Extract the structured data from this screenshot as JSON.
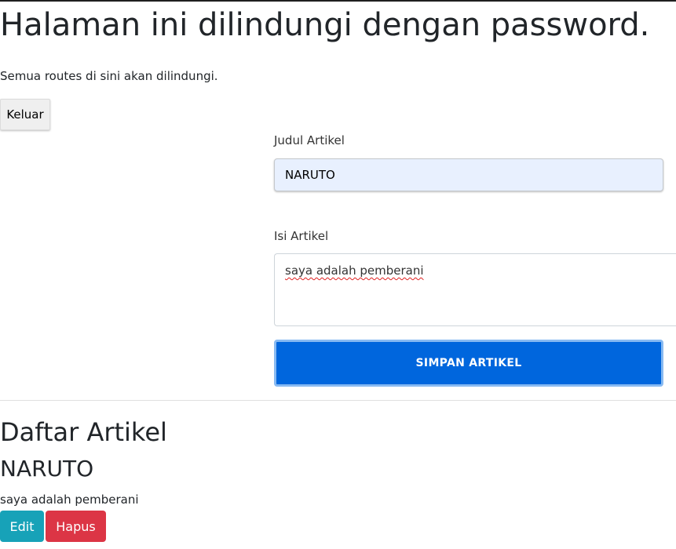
{
  "header": {
    "title": "Halaman ini dilindungi dengan password.",
    "description": "Semua routes di sini akan dilindungi.",
    "logout_label": "Keluar"
  },
  "form": {
    "title_label": "Judul Artikel",
    "title_value": "NARUTO",
    "content_label": "Isi Artikel",
    "content_value": "saya adalah pemberani",
    "save_label": "SIMPAN ARTIKEL"
  },
  "articles": {
    "heading": "Daftar Artikel",
    "items": [
      {
        "title": "NARUTO",
        "body": "saya adalah pemberani",
        "edit_label": "Edit",
        "delete_label": "Hapus"
      }
    ]
  },
  "colors": {
    "primary_button": "#0066dd",
    "edit_button": "#17a2b8",
    "delete_button": "#dc3545",
    "autofill_input": "#e8f0fe"
  }
}
